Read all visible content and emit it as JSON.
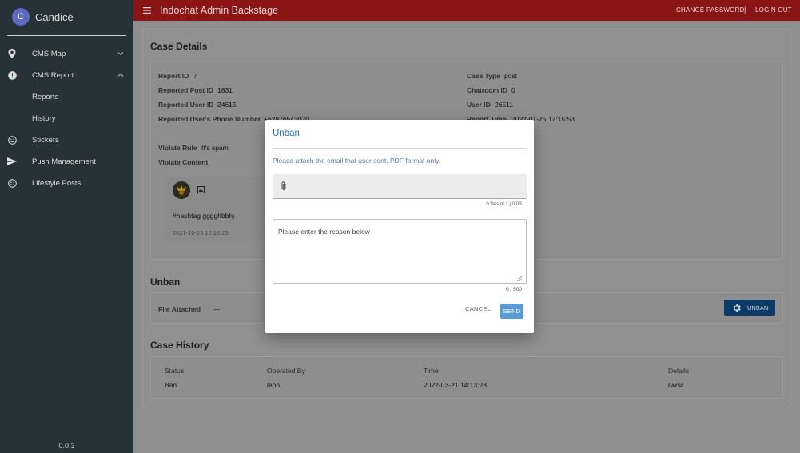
{
  "sidebar": {
    "user_initial": "C",
    "user_name": "Candice",
    "items": [
      {
        "label": "CMS Map",
        "icon": "map-pin-icon"
      },
      {
        "label": "CMS Report",
        "icon": "alert-circle-icon"
      },
      {
        "label": "Reports"
      },
      {
        "label": "History"
      },
      {
        "label": "Stickers",
        "icon": "smiley-icon"
      },
      {
        "label": "Push Management",
        "icon": "send-icon"
      },
      {
        "label": "Lifestyle Posts",
        "icon": "smiley-icon"
      }
    ],
    "version": "0.0.3"
  },
  "topbar": {
    "title": "Indochat Admin Backstage",
    "change_password": "CHANGE PASSWORD",
    "separator": "|",
    "logout": "LOGIN OUT"
  },
  "case_details": {
    "title": "Case Details",
    "left": [
      {
        "label": "Report ID",
        "value": "7"
      },
      {
        "label": "Reported Post ID",
        "value": "1831"
      },
      {
        "label": "Reported User ID",
        "value": "24615"
      },
      {
        "label": "Reported User's Phone Number",
        "value": "+62876543020"
      }
    ],
    "right": [
      {
        "label": "Case Type",
        "value": "post"
      },
      {
        "label": "Chatroom ID",
        "value": "0"
      },
      {
        "label": "User ID",
        "value": "26511"
      },
      {
        "label": "Report Time",
        "value": "2022-01-25 17:15:53"
      }
    ],
    "violate_rule_label": "Violate Rule",
    "violate_rule_value": "It's spam",
    "violate_content_label": "Violate Content",
    "post_text": "#hashtag gggghbbhj",
    "post_time": "2021-10-25 12:16:23"
  },
  "unban_section": {
    "title": "Unban",
    "file_label": "File Attached",
    "file_value": "—",
    "button_label": "UNBAN"
  },
  "case_history": {
    "title": "Case History",
    "headers": [
      "Status",
      "Operated By",
      "Time",
      "Details"
    ],
    "rows": [
      [
        "Ban",
        "leon",
        "2022-03-21 14:13:28",
        "rwrsr"
      ]
    ]
  },
  "dialog": {
    "title": "Unban",
    "instruction": "Please attach the email that user sent. PDF format only.",
    "file_counter": "0 files of 1 | 0.0B",
    "reason_placeholder": "Please enter the reason below",
    "char_counter": "0 / 500",
    "cancel_label": "CANCEL",
    "send_label": "SEND"
  },
  "colors": {
    "topbar": "#8a1515",
    "sidebar": "#263238",
    "accent": "#1f6fc1",
    "send_button": "#5b9bd5",
    "unban_button": "#0d3a66"
  }
}
